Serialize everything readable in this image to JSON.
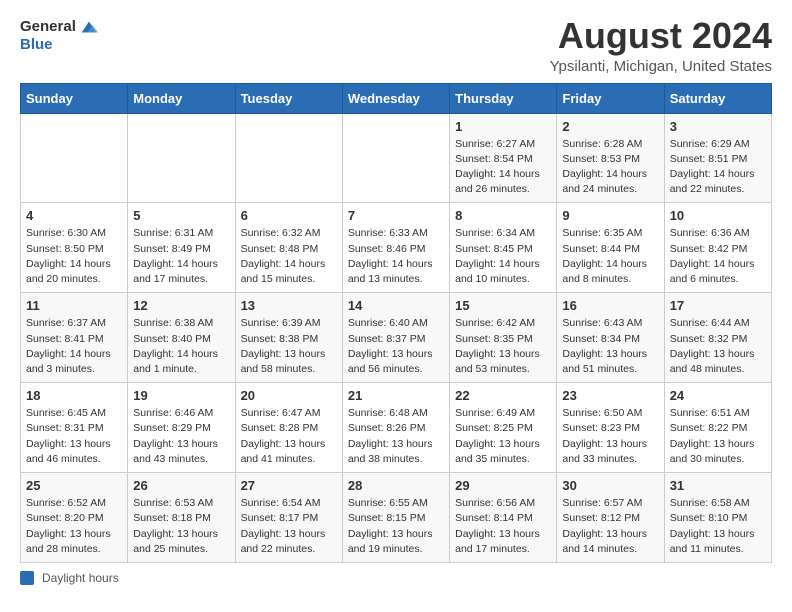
{
  "logo": {
    "general": "General",
    "blue": "Blue"
  },
  "title": "August 2024",
  "subtitle": "Ypsilanti, Michigan, United States",
  "days_header": [
    "Sunday",
    "Monday",
    "Tuesday",
    "Wednesday",
    "Thursday",
    "Friday",
    "Saturday"
  ],
  "legend": {
    "label": "Daylight hours"
  },
  "weeks": [
    [
      {
        "day": "",
        "info": ""
      },
      {
        "day": "",
        "info": ""
      },
      {
        "day": "",
        "info": ""
      },
      {
        "day": "",
        "info": ""
      },
      {
        "day": "1",
        "info": "Sunrise: 6:27 AM\nSunset: 8:54 PM\nDaylight: 14 hours and 26 minutes."
      },
      {
        "day": "2",
        "info": "Sunrise: 6:28 AM\nSunset: 8:53 PM\nDaylight: 14 hours and 24 minutes."
      },
      {
        "day": "3",
        "info": "Sunrise: 6:29 AM\nSunset: 8:51 PM\nDaylight: 14 hours and 22 minutes."
      }
    ],
    [
      {
        "day": "4",
        "info": "Sunrise: 6:30 AM\nSunset: 8:50 PM\nDaylight: 14 hours and 20 minutes."
      },
      {
        "day": "5",
        "info": "Sunrise: 6:31 AM\nSunset: 8:49 PM\nDaylight: 14 hours and 17 minutes."
      },
      {
        "day": "6",
        "info": "Sunrise: 6:32 AM\nSunset: 8:48 PM\nDaylight: 14 hours and 15 minutes."
      },
      {
        "day": "7",
        "info": "Sunrise: 6:33 AM\nSunset: 8:46 PM\nDaylight: 14 hours and 13 minutes."
      },
      {
        "day": "8",
        "info": "Sunrise: 6:34 AM\nSunset: 8:45 PM\nDaylight: 14 hours and 10 minutes."
      },
      {
        "day": "9",
        "info": "Sunrise: 6:35 AM\nSunset: 8:44 PM\nDaylight: 14 hours and 8 minutes."
      },
      {
        "day": "10",
        "info": "Sunrise: 6:36 AM\nSunset: 8:42 PM\nDaylight: 14 hours and 6 minutes."
      }
    ],
    [
      {
        "day": "11",
        "info": "Sunrise: 6:37 AM\nSunset: 8:41 PM\nDaylight: 14 hours and 3 minutes."
      },
      {
        "day": "12",
        "info": "Sunrise: 6:38 AM\nSunset: 8:40 PM\nDaylight: 14 hours and 1 minute."
      },
      {
        "day": "13",
        "info": "Sunrise: 6:39 AM\nSunset: 8:38 PM\nDaylight: 13 hours and 58 minutes."
      },
      {
        "day": "14",
        "info": "Sunrise: 6:40 AM\nSunset: 8:37 PM\nDaylight: 13 hours and 56 minutes."
      },
      {
        "day": "15",
        "info": "Sunrise: 6:42 AM\nSunset: 8:35 PM\nDaylight: 13 hours and 53 minutes."
      },
      {
        "day": "16",
        "info": "Sunrise: 6:43 AM\nSunset: 8:34 PM\nDaylight: 13 hours and 51 minutes."
      },
      {
        "day": "17",
        "info": "Sunrise: 6:44 AM\nSunset: 8:32 PM\nDaylight: 13 hours and 48 minutes."
      }
    ],
    [
      {
        "day": "18",
        "info": "Sunrise: 6:45 AM\nSunset: 8:31 PM\nDaylight: 13 hours and 46 minutes."
      },
      {
        "day": "19",
        "info": "Sunrise: 6:46 AM\nSunset: 8:29 PM\nDaylight: 13 hours and 43 minutes."
      },
      {
        "day": "20",
        "info": "Sunrise: 6:47 AM\nSunset: 8:28 PM\nDaylight: 13 hours and 41 minutes."
      },
      {
        "day": "21",
        "info": "Sunrise: 6:48 AM\nSunset: 8:26 PM\nDaylight: 13 hours and 38 minutes."
      },
      {
        "day": "22",
        "info": "Sunrise: 6:49 AM\nSunset: 8:25 PM\nDaylight: 13 hours and 35 minutes."
      },
      {
        "day": "23",
        "info": "Sunrise: 6:50 AM\nSunset: 8:23 PM\nDaylight: 13 hours and 33 minutes."
      },
      {
        "day": "24",
        "info": "Sunrise: 6:51 AM\nSunset: 8:22 PM\nDaylight: 13 hours and 30 minutes."
      }
    ],
    [
      {
        "day": "25",
        "info": "Sunrise: 6:52 AM\nSunset: 8:20 PM\nDaylight: 13 hours and 28 minutes."
      },
      {
        "day": "26",
        "info": "Sunrise: 6:53 AM\nSunset: 8:18 PM\nDaylight: 13 hours and 25 minutes."
      },
      {
        "day": "27",
        "info": "Sunrise: 6:54 AM\nSunset: 8:17 PM\nDaylight: 13 hours and 22 minutes."
      },
      {
        "day": "28",
        "info": "Sunrise: 6:55 AM\nSunset: 8:15 PM\nDaylight: 13 hours and 19 minutes."
      },
      {
        "day": "29",
        "info": "Sunrise: 6:56 AM\nSunset: 8:14 PM\nDaylight: 13 hours and 17 minutes."
      },
      {
        "day": "30",
        "info": "Sunrise: 6:57 AM\nSunset: 8:12 PM\nDaylight: 13 hours and 14 minutes."
      },
      {
        "day": "31",
        "info": "Sunrise: 6:58 AM\nSunset: 8:10 PM\nDaylight: 13 hours and 11 minutes."
      }
    ]
  ]
}
